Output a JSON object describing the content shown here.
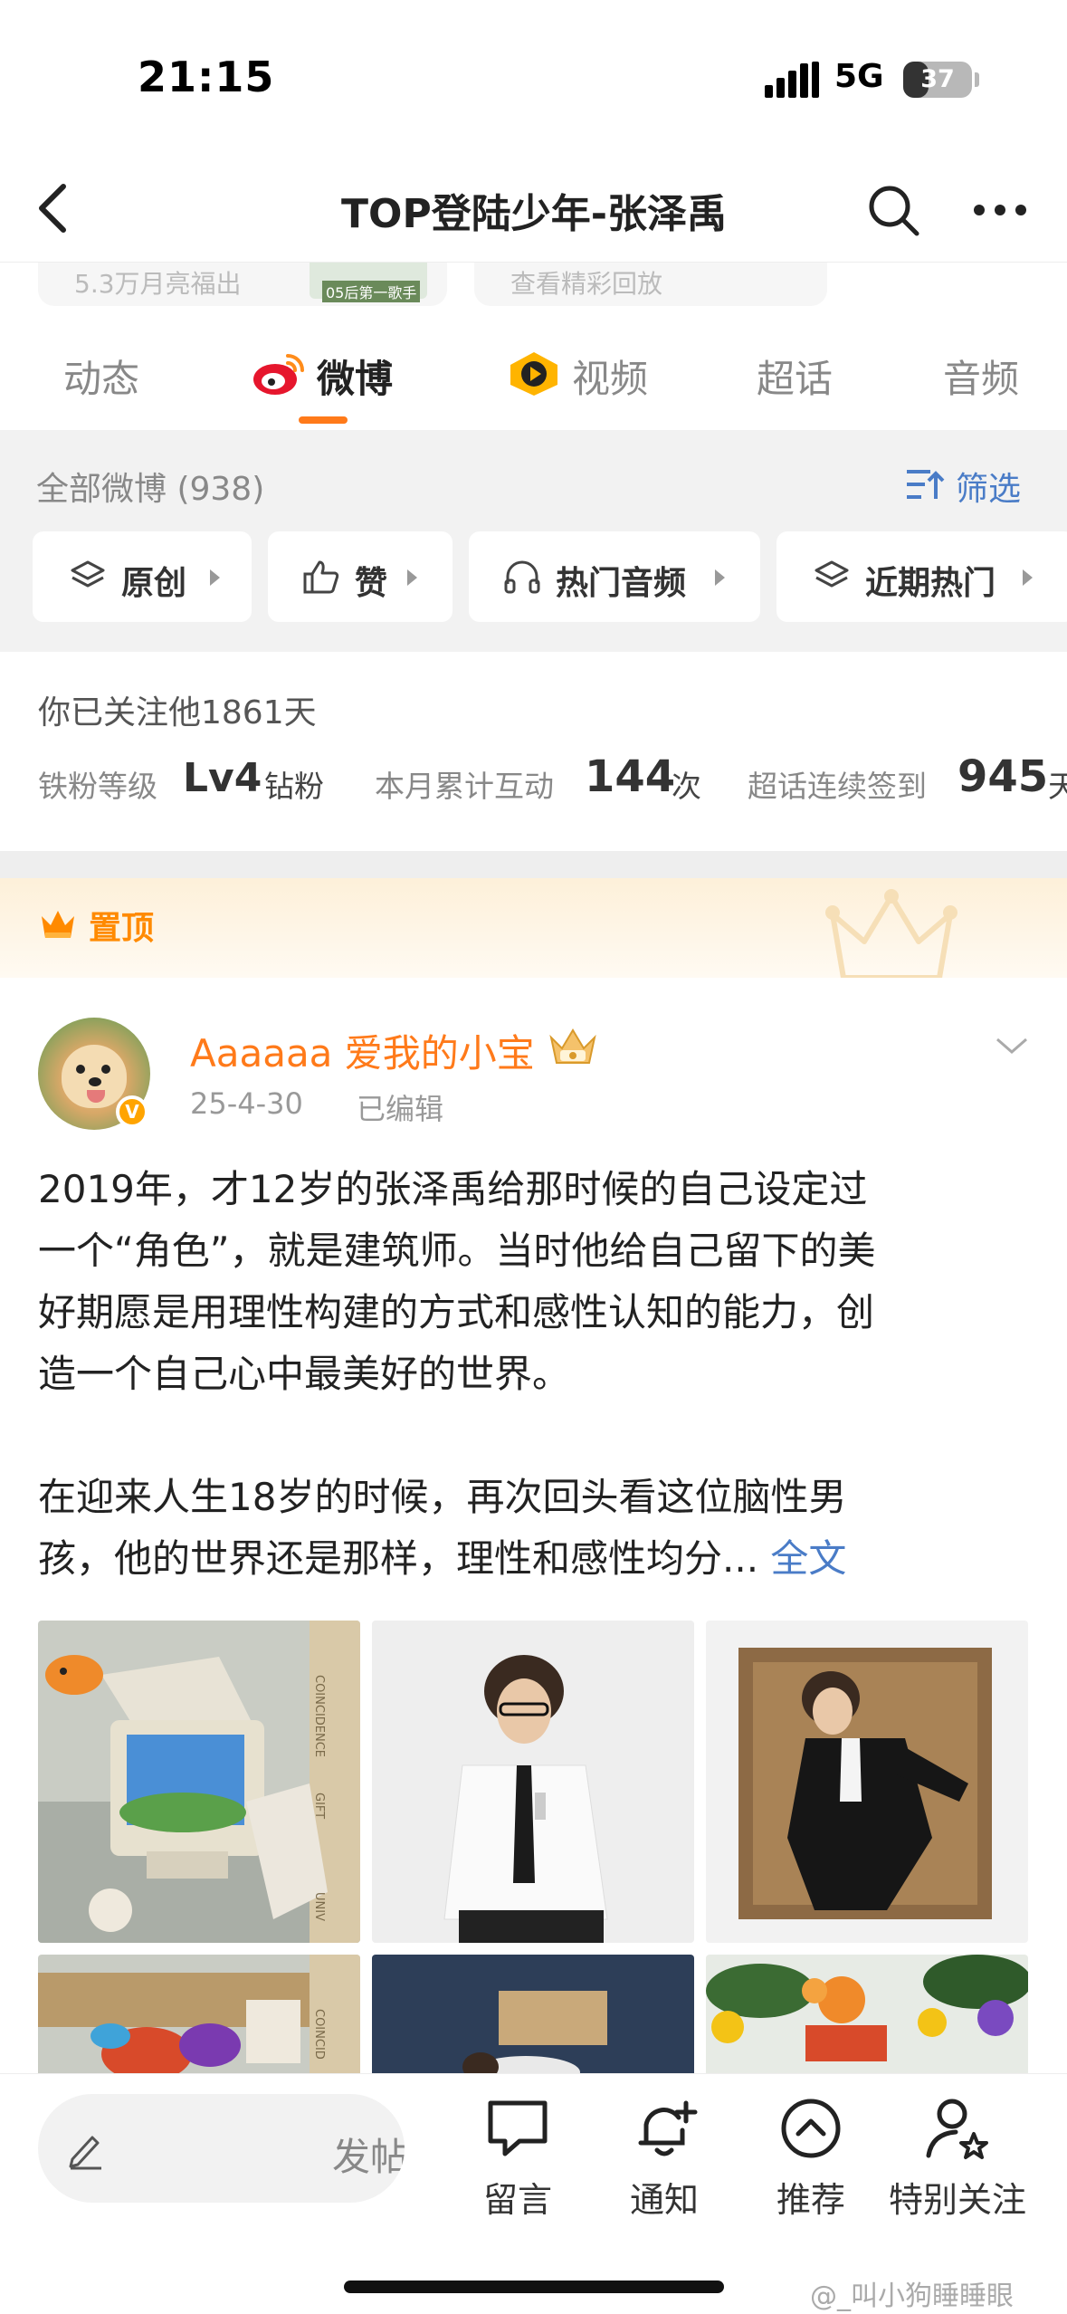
{
  "status_bar": {
    "time": "21:15",
    "network": "5G",
    "battery": "37",
    "battery_level": 0.37
  },
  "nav": {
    "title": "TOP登陆少年-张泽禹"
  },
  "peek_cards": [
    {
      "text": "5.3万月亮福出",
      "thumb_caption": "05后第一歌手"
    },
    {
      "text": "查看精彩回放"
    }
  ],
  "tabs": [
    {
      "label": "动态"
    },
    {
      "label": "微博",
      "active": true
    },
    {
      "label": "视频"
    },
    {
      "label": "超话"
    },
    {
      "label": "音频"
    }
  ],
  "filter": {
    "all_label": "全部微博 (938)",
    "filter_label": "筛选",
    "chips": [
      {
        "label": "原创",
        "icon": "layers-icon"
      },
      {
        "label": "赞",
        "icon": "thumbs-up-icon"
      },
      {
        "label": "热门音频",
        "icon": "headphones-icon"
      },
      {
        "label": "近期热门",
        "icon": "layers-icon"
      }
    ]
  },
  "follow": {
    "days": "你已关注他1861天",
    "stats": [
      {
        "label": "铁粉等级",
        "value": "Lv4",
        "unit": "钻粉"
      },
      {
        "label": "本月累计互动",
        "value": "144",
        "unit": "次"
      },
      {
        "label": "超话连续签到",
        "value": "945",
        "unit": "天"
      }
    ]
  },
  "pinned": {
    "label": "置顶"
  },
  "post": {
    "username": "Aaaaaa 爱我的小宝",
    "date": "25-4-30",
    "edited": "已编辑",
    "paragraph1_lines": [
      "2019年，才12岁的张泽禹给那时候的自己设定过",
      "一个“角色”，就是建筑师。当时他给自己留下的美",
      "好期愿是用理性构建的方式和感性认知的能力，创",
      "造一个自己心中最美好的世界。"
    ],
    "paragraph2_lines": [
      "在迎来人生18岁的时候，再次回头看这位脑性男",
      "孩，他的世界还是那样，理性和感性均分..."
    ],
    "more_link": "全文",
    "image_texts": [
      "COINCIDENCE",
      "GIFT",
      "UNIV",
      "COINCID"
    ]
  },
  "bottom_bar": {
    "comment_placeholder": "发帖",
    "items": [
      {
        "label": "留言",
        "icon": "message-icon"
      },
      {
        "label": "通知",
        "icon": "bell-plus-icon"
      },
      {
        "label": "推荐",
        "icon": "up-circle-icon"
      },
      {
        "label": "特别关注",
        "icon": "user-star-icon"
      }
    ]
  },
  "watermark": "@_叫小狗睡睡眼"
}
